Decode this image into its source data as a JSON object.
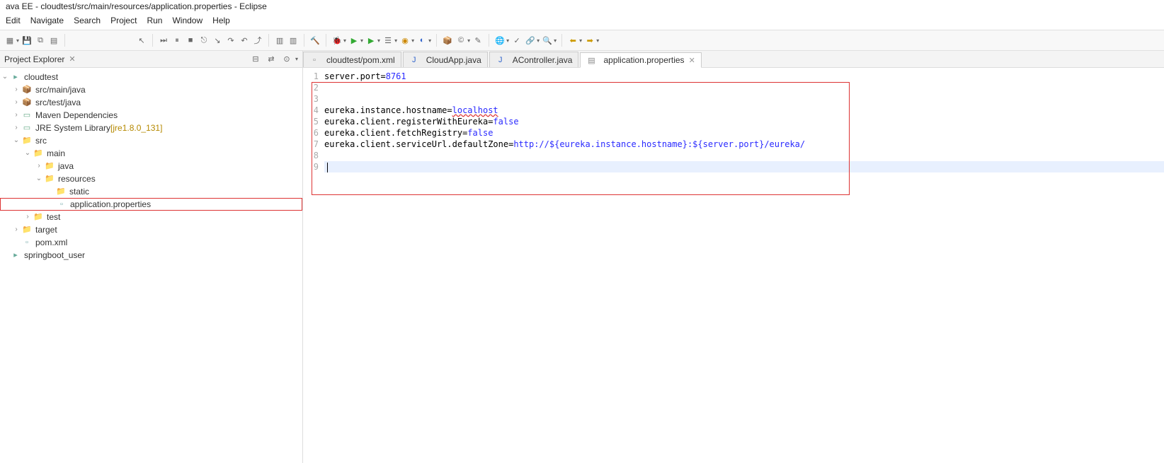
{
  "title": "ava EE - cloudtest/src/main/resources/application.properties - Eclipse",
  "menus": [
    "Edit",
    "Navigate",
    "Search",
    "Project",
    "Run",
    "Window",
    "Help"
  ],
  "explorer": {
    "title": "Project Explorer",
    "tree": {
      "project": "cloudtest",
      "nodes": [
        {
          "icon": "pkg",
          "label": "src/main/java",
          "indent": 1,
          "twisty": ">"
        },
        {
          "icon": "pkg",
          "label": "src/test/java",
          "indent": 1,
          "twisty": ">"
        },
        {
          "icon": "jar",
          "label": "Maven Dependencies",
          "indent": 1,
          "twisty": ">"
        },
        {
          "icon": "jar",
          "label": "JRE System Library",
          "suffix": "[jre1.8.0_131]",
          "indent": 1,
          "twisty": ">"
        },
        {
          "icon": "fld",
          "label": "src",
          "indent": 1,
          "twisty": "v"
        },
        {
          "icon": "fld",
          "label": "main",
          "indent": 2,
          "twisty": "v"
        },
        {
          "icon": "fld",
          "label": "java",
          "indent": 3,
          "twisty": ">"
        },
        {
          "icon": "fld",
          "label": "resources",
          "indent": 3,
          "twisty": "v"
        },
        {
          "icon": "fld",
          "label": "static",
          "indent": 4,
          "twisty": ""
        },
        {
          "icon": "file",
          "label": "application.properties",
          "indent": 4,
          "twisty": "",
          "hl": true
        },
        {
          "icon": "fld",
          "label": "test",
          "indent": 2,
          "twisty": ">"
        },
        {
          "icon": "fld",
          "label": "target",
          "indent": 1,
          "twisty": ">"
        },
        {
          "icon": "file",
          "label": "pom.xml",
          "indent": 1,
          "twisty": ""
        }
      ],
      "project2": "springboot_user"
    }
  },
  "tabs": [
    {
      "icon": "xml",
      "label": "cloudtest/pom.xml"
    },
    {
      "icon": "java",
      "label": "CloudApp.java"
    },
    {
      "icon": "java",
      "label": "AController.java"
    },
    {
      "icon": "prop",
      "label": "application.properties",
      "active": true
    }
  ],
  "code": {
    "lines": [
      {
        "n": 1,
        "segs": [
          {
            "t": "server.port=",
            "c": "kw"
          },
          {
            "t": "8761",
            "c": "val-num"
          }
        ]
      },
      {
        "n": 2,
        "segs": []
      },
      {
        "n": 3,
        "segs": []
      },
      {
        "n": 4,
        "segs": [
          {
            "t": "eureka.instance.hostname=",
            "c": "kw"
          },
          {
            "t": "localhost",
            "c": "val-kw underline"
          }
        ]
      },
      {
        "n": 5,
        "segs": [
          {
            "t": "eureka.client.registerWithEureka=",
            "c": "kw"
          },
          {
            "t": "false",
            "c": "val-kw"
          }
        ]
      },
      {
        "n": 6,
        "segs": [
          {
            "t": "eureka.client.fetchRegistry=",
            "c": "kw"
          },
          {
            "t": "false",
            "c": "val-kw"
          }
        ]
      },
      {
        "n": 7,
        "segs": [
          {
            "t": "eureka.client.serviceUrl.defaultZone=",
            "c": "kw"
          },
          {
            "t": "http://${eureka.instance.hostname}:${server.port}/eureka/",
            "c": "url-val"
          }
        ]
      },
      {
        "n": 8,
        "segs": []
      },
      {
        "n": 9,
        "segs": [],
        "current": true
      }
    ]
  }
}
